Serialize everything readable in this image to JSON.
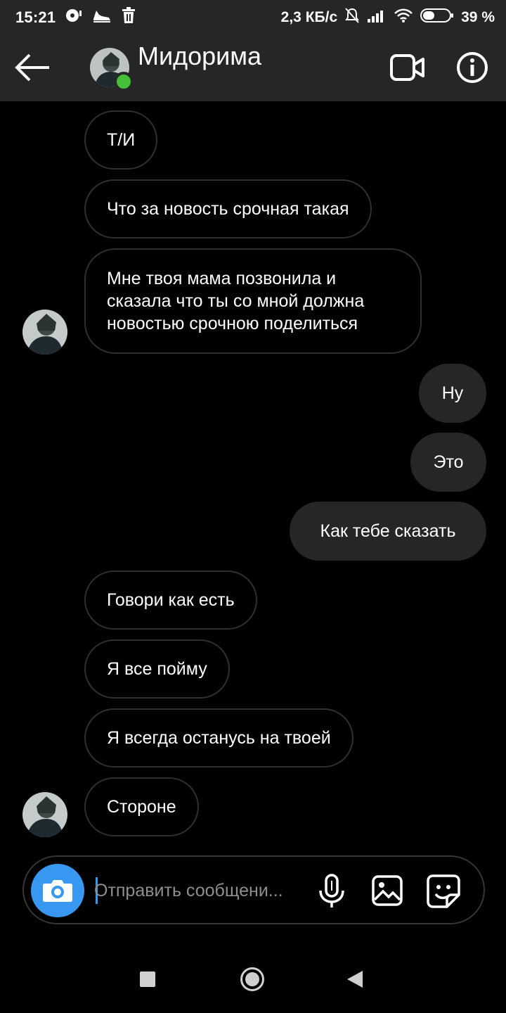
{
  "status_bar": {
    "time": "15:21",
    "speed": "2,3 КБ/с",
    "battery_percent": "39 %",
    "icons": [
      "media-icon",
      "shoe-icon",
      "trash-icon",
      "mute-bell-icon",
      "signal-icon",
      "wifi-icon",
      "battery-icon"
    ]
  },
  "header": {
    "contact_name": "Мидорима",
    "status": "online",
    "icons": [
      "back-arrow-icon",
      "video-call-icon",
      "info-icon"
    ]
  },
  "messages": [
    {
      "from": "them",
      "text": "Т/И"
    },
    {
      "from": "them",
      "text": "Что за новость срочная такая"
    },
    {
      "from": "them",
      "lines": [
        "Мне твоя мама позвонила и",
        "сказала что ты со мной должна",
        "новостью срочною поделиться"
      ]
    },
    {
      "from": "me",
      "text": "Ну"
    },
    {
      "from": "me",
      "text": "Это"
    },
    {
      "from": "me",
      "text": "Как тебе сказать"
    },
    {
      "from": "them",
      "text": "Говори как есть"
    },
    {
      "from": "them",
      "text": "Я все пойму"
    },
    {
      "from": "them",
      "text": "Я всегда останусь на твоей"
    },
    {
      "from": "them",
      "text": "Стороне"
    }
  ],
  "composer": {
    "placeholder": "Отправить сообщени...",
    "icons": [
      "camera-icon",
      "microphone-icon",
      "gallery-icon",
      "sticker-icon"
    ]
  },
  "colors": {
    "background": "#000000",
    "bar": "#262626",
    "sent_bubble": "#262626",
    "received_border": "#2f2f2f",
    "accent": "#3897f0",
    "online": "#45c036"
  }
}
